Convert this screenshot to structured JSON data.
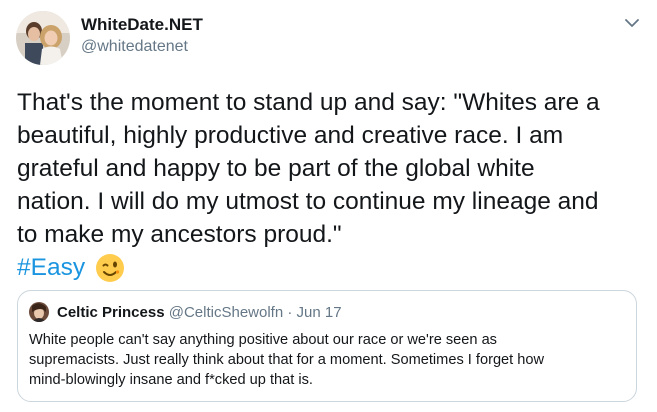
{
  "author": {
    "name": "WhiteDate.NET",
    "handle": "@whitedatenet"
  },
  "tweet": {
    "text_lines": [
      "That's the moment to stand up and say: \"Whites are a",
      "beautiful, highly productive and creative race. I am",
      "grateful and happy to be part of the global white",
      "nation. I will do my utmost to continue my lineage and",
      "to make my ancestors proud.\""
    ],
    "hashtag": "#Easy",
    "emoji": "winking-face"
  },
  "quoted_tweet": {
    "name": "Celtic Princess",
    "handle": "@CelticShewolfn",
    "separator": "·",
    "date": "Jun 17",
    "text_lines": [
      "White people can't say anything positive about our race or we're seen as",
      "supremacists. Just really think about that for a moment. Sometimes I forget how",
      "mind-blowingly insane and f*cked up that is."
    ]
  },
  "colors": {
    "text": "#14171a",
    "secondary": "#657786",
    "link": "#1b95e0",
    "border": "#ccd6dd"
  }
}
